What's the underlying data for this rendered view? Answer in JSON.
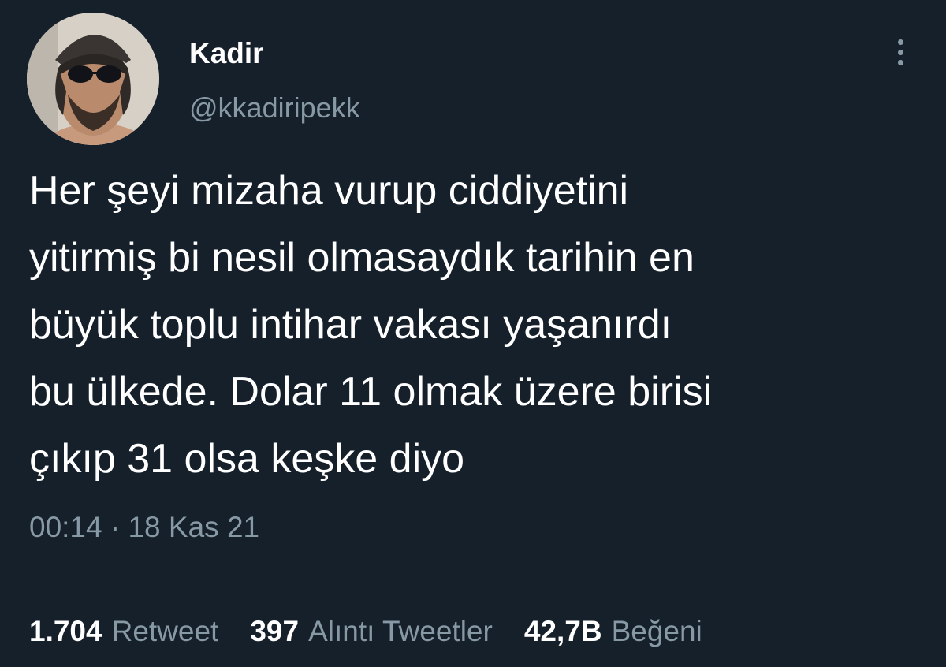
{
  "author": {
    "display_name": "Kadir",
    "handle": "@kkadiripekk"
  },
  "tweet": {
    "text_lines": [
      "Her şeyi mizaha vurup ciddiyetini",
      "yitirmiş bi nesil olmasaydık tarihin en",
      "büyük toplu intihar vakası yaşanırdı",
      "bu ülkede. Dolar 11 olmak üzere birisi",
      "çıkıp 31 olsa keşke diyo"
    ],
    "time": "00:14",
    "separator": "·",
    "date": "18 Kas 21"
  },
  "stats": {
    "retweets": {
      "count": "1.704",
      "label": "Retweet"
    },
    "quotes": {
      "count": "397",
      "label": "Alıntı Tweetler"
    },
    "likes": {
      "count": "42,7B",
      "label": "Beğeni"
    }
  },
  "icons": {
    "more": "more-vertical-icon"
  },
  "colors": {
    "background": "#15202b",
    "primary_text": "#ffffff",
    "secondary_text": "#8899a6",
    "divider": "#38444d"
  }
}
